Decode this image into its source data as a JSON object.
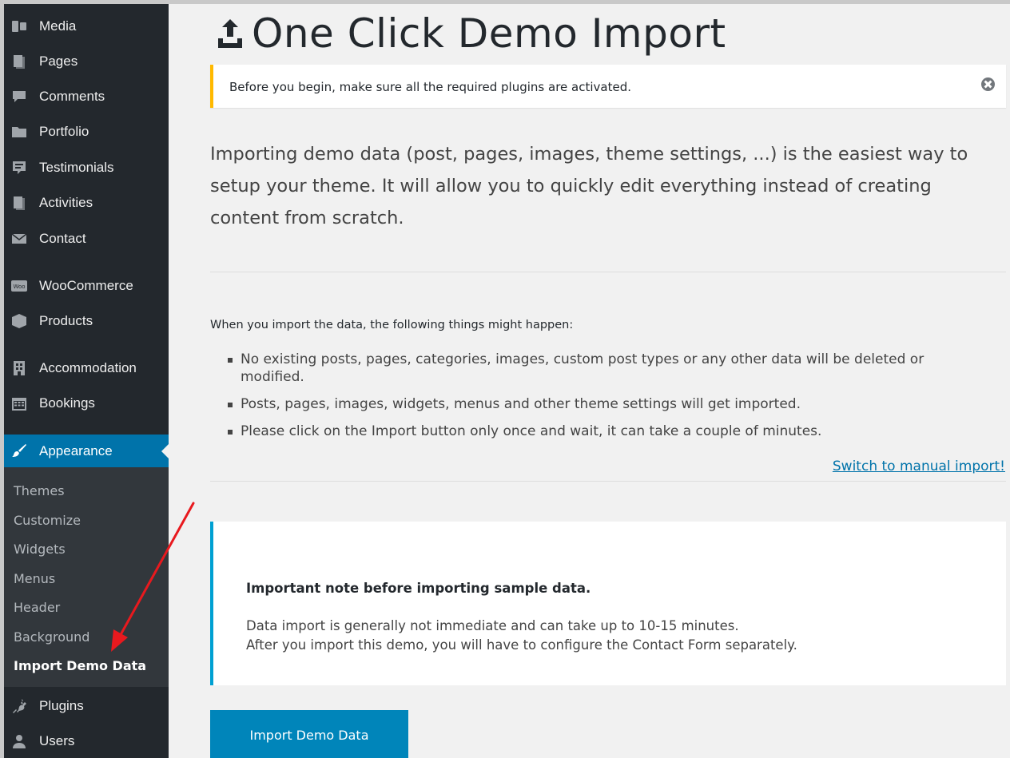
{
  "sidebar": {
    "items": [
      {
        "label": "Media",
        "icon": "media-icon"
      },
      {
        "label": "Pages",
        "icon": "pages-icon"
      },
      {
        "label": "Comments",
        "icon": "comments-icon"
      },
      {
        "label": "Portfolio",
        "icon": "folder-icon"
      },
      {
        "label": "Testimonials",
        "icon": "testimonial-icon"
      },
      {
        "label": "Activities",
        "icon": "pages-icon"
      },
      {
        "label": "Contact",
        "icon": "envelope-icon"
      },
      {
        "label": "WooCommerce",
        "icon": "woocommerce-icon",
        "icon_text": "Woo"
      },
      {
        "label": "Products",
        "icon": "box-icon"
      },
      {
        "label": "Accommodation",
        "icon": "building-icon"
      },
      {
        "label": "Bookings",
        "icon": "calendar-icon"
      },
      {
        "label": "Appearance",
        "icon": "paintbrush-icon"
      },
      {
        "label": "Plugins",
        "icon": "plugin-icon"
      },
      {
        "label": "Users",
        "icon": "user-icon"
      }
    ],
    "submenu": [
      "Themes",
      "Customize",
      "Widgets",
      "Menus",
      "Header",
      "Background",
      "Import Demo Data"
    ]
  },
  "main": {
    "title": "One Click Demo Import",
    "notice": "Before you begin, make sure all the required plugins are activated.",
    "intro": "Importing demo data (post, pages, images, theme settings, ...) is the easiest way to setup your theme. It will allow you to quickly edit everything instead of creating content from scratch.",
    "happen_lead": "When you import the data, the following things might happen:",
    "bullets": [
      "No existing posts, pages, categories, images, custom post types or any other data will be deleted or modified.",
      "Posts, pages, images, widgets, menus and other theme settings will get imported.",
      "Please click on the Import button only once and wait, it can take a couple of minutes."
    ],
    "manual_link": "Switch to manual import!",
    "note_title": "Important note before importing sample data.",
    "note_lines": [
      "Data import is generally not immediate and can take up to 10-15 minutes.",
      "After you import this demo, you will have to configure the Contact Form separately."
    ],
    "import_button": "Import Demo Data"
  },
  "colors": {
    "sidebar_bg": "#23282d",
    "active_bg": "#0073aa",
    "notice_border": "#ffb900",
    "note_border": "#00a0d2",
    "button_bg": "#0085ba",
    "annotation_arrow": "#e8191e"
  }
}
